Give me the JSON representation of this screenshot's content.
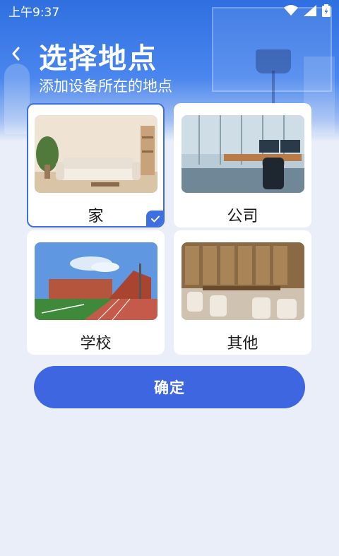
{
  "status_bar": {
    "time": "上午9:37",
    "icons": [
      "wifi-icon",
      "signal-icon",
      "battery-icon"
    ]
  },
  "header": {
    "back_icon": "chevron-left-icon",
    "title": "选择地点",
    "subtitle": "添加设备所在的地点"
  },
  "locations": [
    {
      "label": "家",
      "selected": true,
      "image": "living-room-photo"
    },
    {
      "label": "公司",
      "selected": false,
      "image": "office-photo"
    },
    {
      "label": "学校",
      "selected": false,
      "image": "school-photo"
    },
    {
      "label": "其他",
      "selected": false,
      "image": "restaurant-photo"
    }
  ],
  "confirm_label": "确定",
  "colors": {
    "accent": "#3e6ee0",
    "header": "#3a79e8",
    "background": "#e9eef8",
    "card": "#ffffff"
  }
}
